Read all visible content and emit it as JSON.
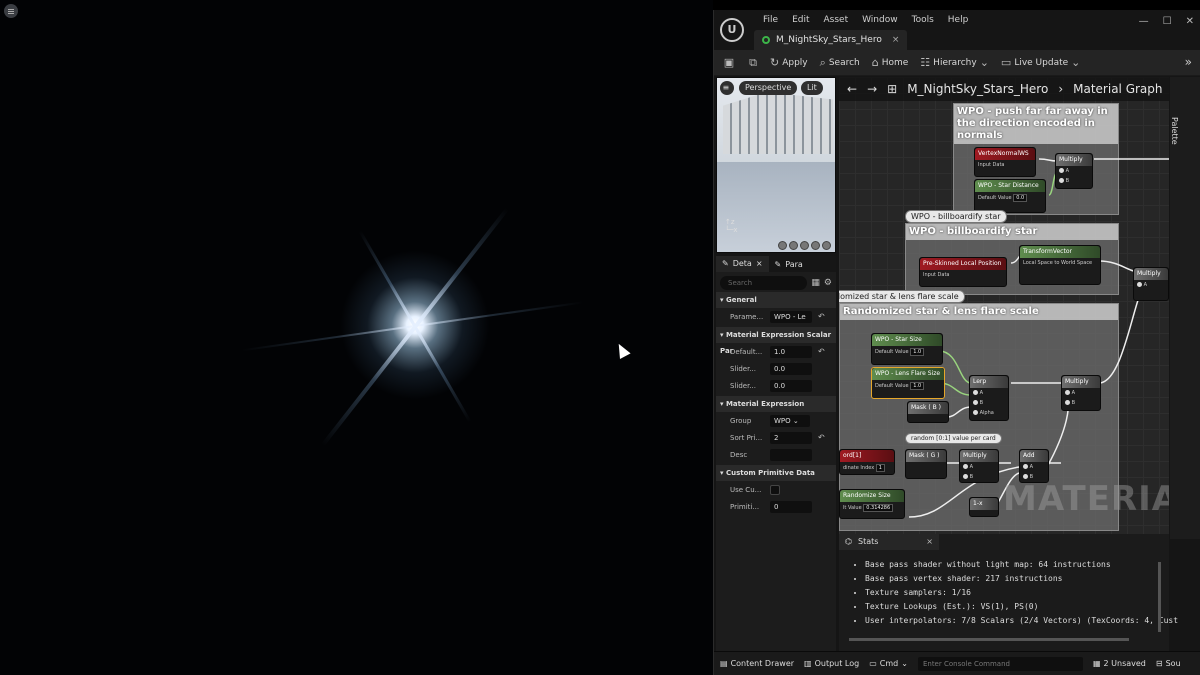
{
  "menu": [
    "File",
    "Edit",
    "Asset",
    "Window",
    "Tools",
    "Help"
  ],
  "window_controls": [
    "—",
    "☐",
    "✕"
  ],
  "document_tab": {
    "title": "M_NightSky_Stars_Hero",
    "close": "×"
  },
  "toolbar": {
    "apply": "Apply",
    "search": "Search",
    "home": "Home",
    "hierarchy": "Hierarchy",
    "live_update": "Live Update"
  },
  "preview": {
    "view_mode": "Perspective",
    "lighting": "Lit"
  },
  "details": {
    "tab_details": "Deta",
    "tab_params": "Para",
    "search_placeholder": "Search",
    "categories": {
      "general": "General",
      "scalar": "Material Expression Scalar Par",
      "expression": "Material Expression",
      "custom": "Custom Primitive Data"
    },
    "props": {
      "parameter_name": {
        "label": "Parame...",
        "value": "WPO - Le"
      },
      "default_value": {
        "label": "Default...",
        "value": "1.0"
      },
      "slider_min": {
        "label": "Slider...",
        "value": "0.0"
      },
      "slider_max": {
        "label": "Slider...",
        "value": "0.0"
      },
      "group": {
        "label": "Group",
        "value": "WPO"
      },
      "sort_priority": {
        "label": "Sort Pri...",
        "value": "2"
      },
      "desc": {
        "label": "Desc",
        "value": ""
      },
      "use_custom": {
        "label": "Use Cu..."
      },
      "primitive": {
        "label": "Primiti...",
        "value": "0"
      }
    }
  },
  "graph": {
    "breadcrumb_asset": "M_NightSky_Stars_Hero",
    "breadcrumb_graph": "Material Graph",
    "comments": {
      "wpo_push": "WPO - push far far away in the direction encoded in normals",
      "wpo_billboard": "WPO - billboardify star",
      "randomized": "domized star & lens flare scale",
      "randomized_title": "Randomized star & lens flare scale"
    },
    "bubbles": {
      "billboard": "WPO - billboardify star",
      "random": "random [0:1] value per card"
    },
    "nodes": {
      "vertex_normal": {
        "title": "VertexNormalWS",
        "sub": "Input Data"
      },
      "multiply_1": {
        "title": "Multiply"
      },
      "star_distance": {
        "title": "WPO - Star Distance",
        "default_label": "Default Value",
        "default": "0.0"
      },
      "pre_skinned": {
        "title": "Pre-Skinned Local Position",
        "sub": "Input Data"
      },
      "transform_vector": {
        "title": "TransformVector",
        "sub": "Local Space to World Space"
      },
      "multiply_2": {
        "title": "Multiply"
      },
      "star_size": {
        "title": "WPO - Star Size",
        "default_label": "Default Value",
        "default": "1.0"
      },
      "lens_flare_size": {
        "title": "WPO - Lens Flare Size",
        "default_label": "Default Value",
        "default": "1.0"
      },
      "lerp": {
        "title": "Lerp"
      },
      "multiply_3": {
        "title": "Multiply"
      },
      "mask_b": {
        "title": "Mask ( B )"
      },
      "mask_g": {
        "title": "Mask ( G )"
      },
      "multiply_4": {
        "title": "Multiply"
      },
      "add": {
        "title": "Add"
      },
      "coord": {
        "title": "ord[1]",
        "index_label": "dinate Index",
        "index": "1"
      },
      "randomize_size": {
        "title": "Randomize Size",
        "default_label": "lt Value",
        "default": "0.314286"
      },
      "one_minus": {
        "title": "1-x"
      }
    },
    "watermark": "MATERIAL"
  },
  "palette": "Palette",
  "stats": {
    "tab": "Stats",
    "lines": [
      "Base pass shader without light map: 64 instructions",
      "Base pass vertex shader: 217 instructions",
      "Texture samplers: 1/16",
      "Texture Lookups (Est.): VS(1), PS(0)",
      "User interpolators: 7/8 Scalars (2/4 Vectors) (TexCoords: 4, Cust"
    ]
  },
  "bottombar": {
    "content_drawer": "Content Drawer",
    "output_log": "Output Log",
    "cmd": "Cmd",
    "console_placeholder": "Enter Console Command",
    "unsaved": "2 Unsaved",
    "source": "Sou"
  }
}
